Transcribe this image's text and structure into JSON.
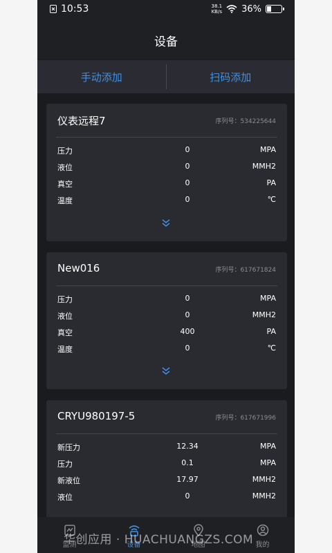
{
  "status_bar": {
    "time": "10:53",
    "net_speed_top": "38.1",
    "net_speed_bottom": "KB/s",
    "battery": "36%",
    "battery_level": 0.36
  },
  "header": {
    "title": "设备"
  },
  "add_bar": {
    "manual_label": "手动添加",
    "scan_label": "扫码添加"
  },
  "devices": [
    {
      "name": "仪表远程7",
      "serial": "序列号：534225644",
      "rows": [
        {
          "label": "压力",
          "value": "0",
          "unit": "MPA"
        },
        {
          "label": "液位",
          "value": "0",
          "unit": "MMH2"
        },
        {
          "label": "真空",
          "value": "0",
          "unit": "PA"
        },
        {
          "label": "温度",
          "value": "0",
          "unit": "℃"
        }
      ]
    },
    {
      "name": "New016",
      "serial": "序列号：617671824",
      "rows": [
        {
          "label": "压力",
          "value": "0",
          "unit": "MPA"
        },
        {
          "label": "液位",
          "value": "0",
          "unit": "MMH2"
        },
        {
          "label": "真空",
          "value": "400",
          "unit": "PA"
        },
        {
          "label": "温度",
          "value": "0",
          "unit": "℃"
        }
      ]
    },
    {
      "name": "CRYU980197-5",
      "serial": "序列号：617671996",
      "rows": [
        {
          "label": "新压力",
          "value": "12.34",
          "unit": "MPA"
        },
        {
          "label": "压力",
          "value": "0.1",
          "unit": "MPA"
        },
        {
          "label": "新液位",
          "value": "17.97",
          "unit": "MMH2"
        },
        {
          "label": "液位",
          "value": "0",
          "unit": "MMH2"
        }
      ]
    }
  ],
  "tabs": [
    {
      "label": "监测"
    },
    {
      "label": "设备"
    },
    {
      "label": "地图"
    },
    {
      "label": "我的"
    }
  ],
  "watermark": "华创应用 · HUACHUANGZS.COM",
  "colors": {
    "accent": "#3f8fe6",
    "background": "#1a1b1f",
    "card": "#2a2b30"
  }
}
